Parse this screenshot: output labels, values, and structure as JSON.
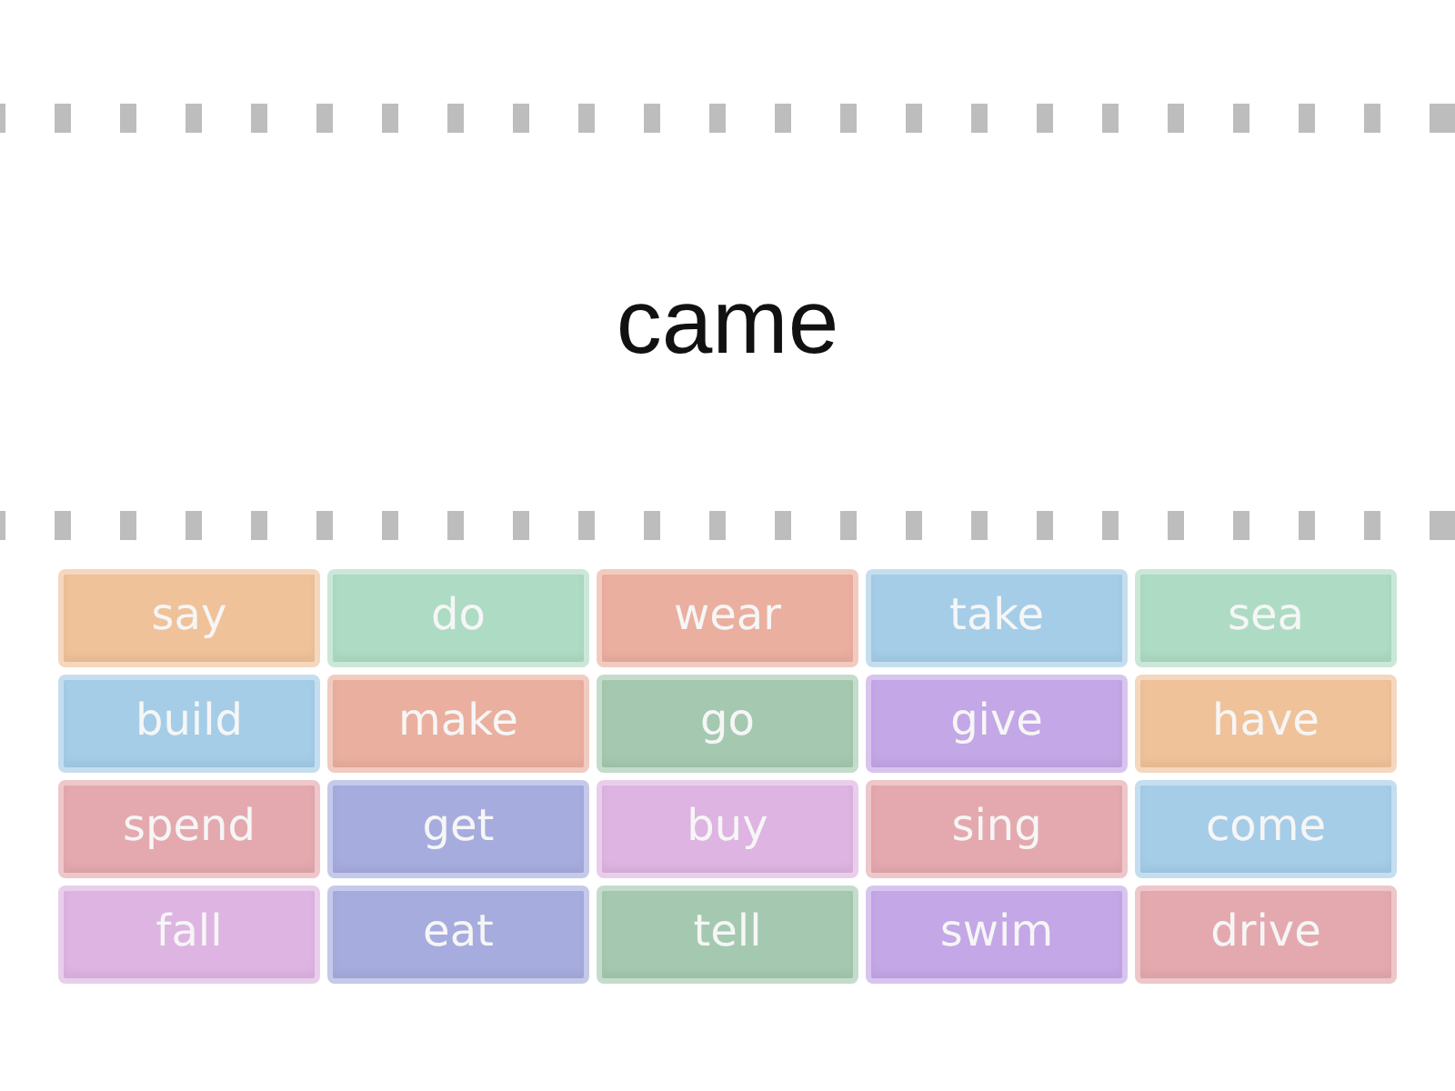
{
  "question": {
    "text": "came"
  },
  "answers": [
    {
      "label": "say",
      "color": "#f0c29a"
    },
    {
      "label": "do",
      "color": "#aedbc4"
    },
    {
      "label": "wear",
      "color": "#eaaf9f"
    },
    {
      "label": "take",
      "color": "#a5cde8"
    },
    {
      "label": "sea",
      "color": "#aedbc4"
    },
    {
      "label": "build",
      "color": "#a5cde8"
    },
    {
      "label": "make",
      "color": "#eaaf9f"
    },
    {
      "label": "go",
      "color": "#a5c9b0"
    },
    {
      "label": "give",
      "color": "#c3a7e6"
    },
    {
      "label": "have",
      "color": "#f0c29a"
    },
    {
      "label": "spend",
      "color": "#e4a9ae"
    },
    {
      "label": "get",
      "color": "#a7acdf"
    },
    {
      "label": "buy",
      "color": "#deb4e2"
    },
    {
      "label": "sing",
      "color": "#e4a9ae"
    },
    {
      "label": "come",
      "color": "#a5cde8"
    },
    {
      "label": "fall",
      "color": "#deb4e2"
    },
    {
      "label": "eat",
      "color": "#a7acdf"
    },
    {
      "label": "tell",
      "color": "#a5c9b0"
    },
    {
      "label": "swim",
      "color": "#c3a7e6"
    },
    {
      "label": "drive",
      "color": "#e4a9ae"
    }
  ]
}
